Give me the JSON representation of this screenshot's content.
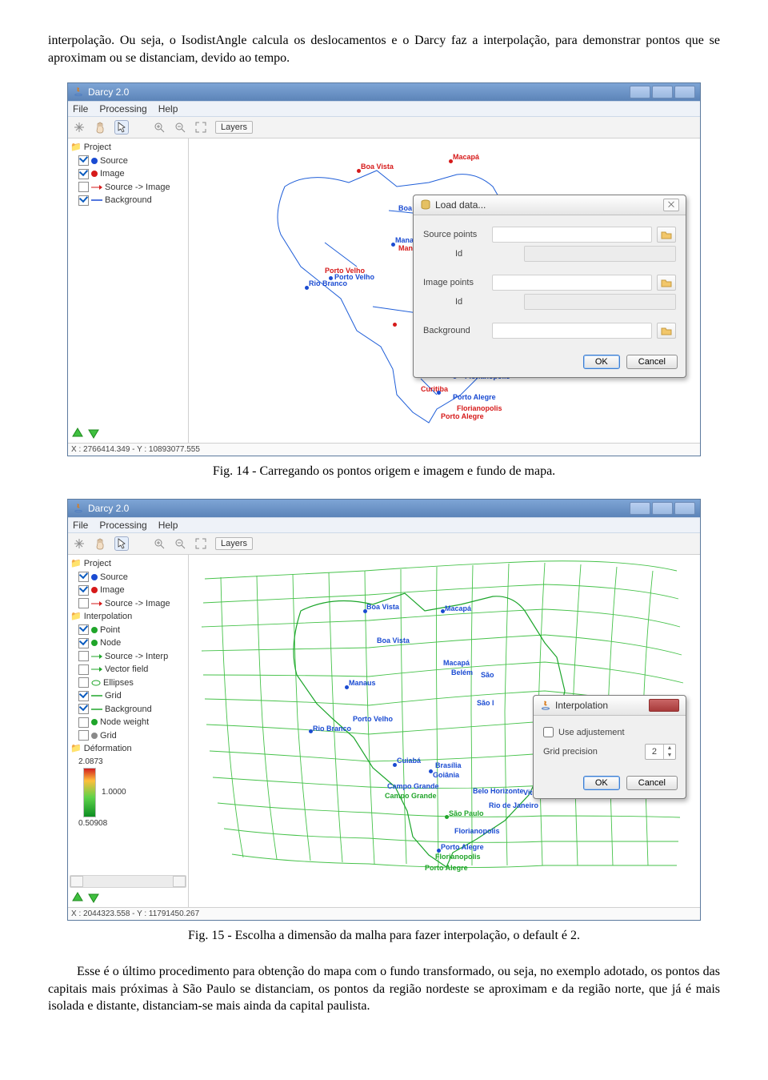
{
  "para1": "interpolação. Ou seja, o IsodistAngle calcula os deslocamentos e o Darcy faz a interpolação, para demonstrar pontos que se aproximam ou se distanciam, devido ao tempo.",
  "caption1": "Fig. 14 - Carregando os pontos origem e imagem e fundo de mapa.",
  "caption2": "Fig. 15 - Escolha a dimensão da malha para fazer interpolação, o default é 2.",
  "para2": "Esse é o último procedimento para obtenção do mapa com o fundo transformado, ou seja, no exemplo adotado, os pontos das capitais mais próximas à São Paulo se distanciam, os pontos da região nordeste se aproximam e da região norte, que já é mais isolada e distante, distanciam-se mais ainda da capital paulista.",
  "app": {
    "title": "Darcy 2.0",
    "menus": [
      "File",
      "Processing",
      "Help"
    ],
    "layers_btn": "Layers",
    "status1": "X : 2766414.349 - Y : 10893077.555",
    "status2": "X : 2044323.558 - Y : 11791450.267"
  },
  "tree1": {
    "root": "Project",
    "items": [
      {
        "label": "Source",
        "checked": true,
        "color": "#1a4bd2"
      },
      {
        "label": "Image",
        "checked": true,
        "color": "#d61a1a"
      },
      {
        "label": "Source -> Image",
        "checked": false,
        "arrow": "#d61a1a"
      },
      {
        "label": "Background",
        "checked": true,
        "line": "#1a4bd2"
      }
    ]
  },
  "tree2": {
    "root": "Project",
    "items": [
      {
        "label": "Source",
        "checked": true,
        "color": "#1a4bd2"
      },
      {
        "label": "Image",
        "checked": true,
        "color": "#d61a1a"
      },
      {
        "label": "Source -> Image",
        "checked": false,
        "arrow": "#d61a1a"
      }
    ],
    "interp": "Interpolation",
    "interpItems": [
      {
        "label": "Point",
        "checked": true,
        "dot": "#20a52a"
      },
      {
        "label": "Node",
        "checked": true,
        "dot": "#20a52a"
      },
      {
        "label": "Source -> Interp",
        "checked": false,
        "arrow": "#20a52a"
      },
      {
        "label": "Vector field",
        "checked": false,
        "arrow": "#20a52a"
      },
      {
        "label": "Ellipses",
        "checked": false,
        "el": "#20a52a"
      },
      {
        "label": "Grid",
        "checked": true,
        "line": "#20a52a"
      },
      {
        "label": "Background",
        "checked": true,
        "line": "#20a52a"
      },
      {
        "label": "Node weight",
        "checked": false,
        "dot": "#20a52a"
      },
      {
        "label": "Grid",
        "checked": false,
        "dot": "#8a8a8a"
      }
    ],
    "deform": "Déformation",
    "deformHi": "2.0873",
    "deformMid": "1.0000",
    "deformLo": "0.50908"
  },
  "dlg1": {
    "title": "Load data...",
    "src": "Source points",
    "id": "Id",
    "img": "Image points",
    "bg": "Background",
    "ok": "OK",
    "cancel": "Cancel"
  },
  "dlg2": {
    "title": "Interpolation",
    "adj": "Use adjustement",
    "grid": "Grid precision",
    "val": "2",
    "ok": "OK",
    "cancel": "Cancel"
  },
  "cities": {
    "bv": "Boa Vista",
    "ma": "Macapá",
    "be": "Belém",
    "mn": "Manaus",
    "man": "Mana",
    "pv": "Porto Velho",
    "rb": "Rio Branco",
    "sao": "São",
    "sao2": "São l",
    "cg": "Campo Grande",
    "cu": "Cuiabá",
    "br": "Brasília",
    "go": "Goiânia",
    "bh": "Belo Horizonte",
    "vit": "Vitória",
    "rj": "Rio de Janeiro",
    "sp": "São Paulo",
    "ct": "Curitiba",
    "fl": "Florianopolis",
    "pa": "Porto Alegre"
  }
}
